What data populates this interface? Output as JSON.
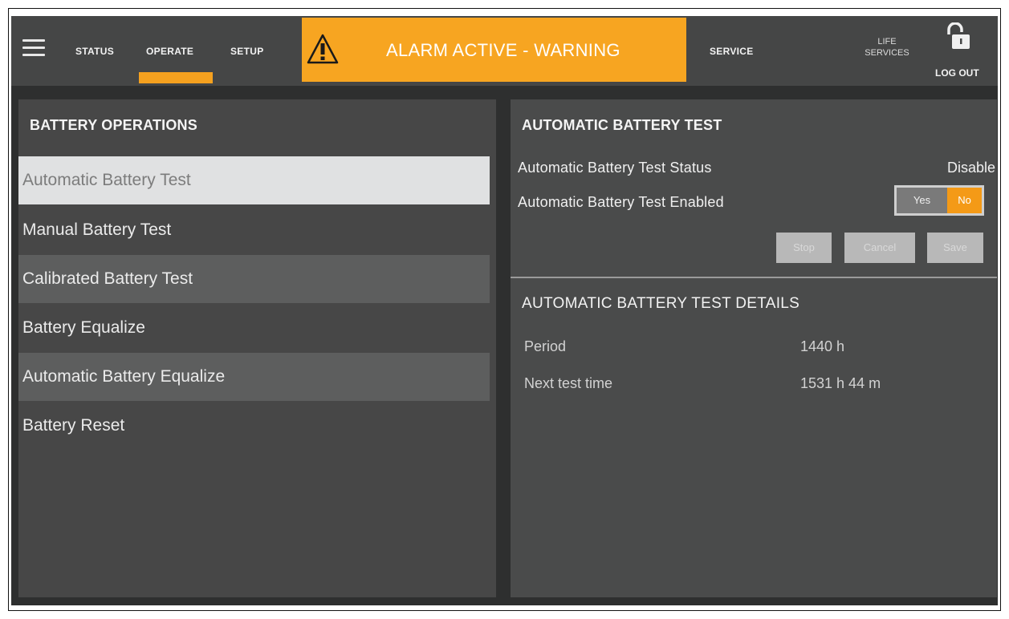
{
  "nav": {
    "status": "STATUS",
    "operate": "OPERATE",
    "setup": "SETUP",
    "service": "SERVICE",
    "life_services": "LIFE\nSERVICES",
    "logout": "LOG OUT"
  },
  "alarm": {
    "text": "ALARM ACTIVE - WARNING",
    "icon": "warning-icon",
    "color": "#f7a521"
  },
  "left_panel": {
    "title": "BATTERY OPERATIONS",
    "items": [
      "Automatic Battery Test",
      "Manual Battery Test",
      "Calibrated Battery Test",
      "Battery Equalize",
      "Automatic Battery Equalize",
      "Battery Reset"
    ],
    "selected": "Automatic Battery Test"
  },
  "right_panel": {
    "title": "AUTOMATIC BATTERY TEST",
    "status_label": "Automatic Battery Test Status",
    "status_value": "Disable",
    "enabled_label": "Automatic Battery Test Enabled",
    "toggle": {
      "yes": "Yes",
      "no": "No",
      "selected": "No"
    },
    "buttons": {
      "stop": "Stop",
      "cancel": "Cancel",
      "save": "Save"
    },
    "details_title": "AUTOMATIC BATTERY TEST DETAILS",
    "details": [
      {
        "label": "Period",
        "value": "1440 h"
      },
      {
        "label": "Next test time",
        "value": "1531 h 44 m"
      }
    ]
  },
  "colors": {
    "accent": "#f5a11f",
    "background": "#2e2f2f",
    "panel": "#474747"
  }
}
